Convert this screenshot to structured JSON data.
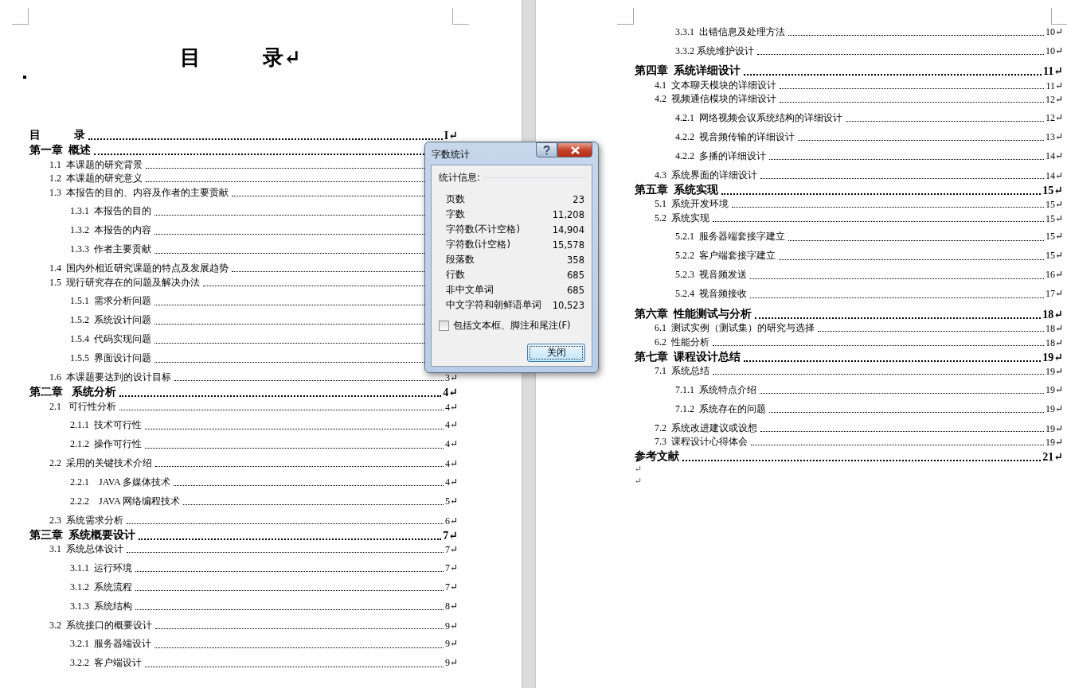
{
  "left_page": {
    "title": "目　　　录↵",
    "entries": [
      {
        "text": "目　　　录",
        "page": "I↵"
      },
      {
        "text": "第一章  概述",
        "children": [
          {
            "text": "1.1  本课题的研究背景"
          },
          {
            "text": "1.2  本课题的研究意义"
          },
          {
            "text": "1.3  本报告的目的、内容及作者的主要贡献",
            "children": [
              {
                "text": "1.3.1  本报告的目的"
              },
              {
                "text": "1.3.2  本报告的内容"
              },
              {
                "text": "1.3.3  作者主要贡献"
              }
            ]
          },
          {
            "text": "1.4  国内外相近研究课题的特点及发展趋势"
          },
          {
            "text": "1.5  现行研究存在的问题及解决办法",
            "children": [
              {
                "text": "1.5.1  需求分析问题"
              },
              {
                "text": "1.5.2  系统设计问题"
              },
              {
                "text": "1.5.4  代码实现问题"
              },
              {
                "text": "1.5.5  界面设计问题"
              }
            ]
          },
          {
            "text": "1.6  本课题要达到的设计目标",
            "page": "3↵"
          }
        ]
      },
      {
        "text": "第二章   系统分析",
        "page": "4↵",
        "children": [
          {
            "text": "2.1   可行性分析",
            "page": "4↵",
            "children": [
              {
                "text": "2.1.1  技术可行性",
                "page": "4↵"
              },
              {
                "text": "2.1.2  操作可行性",
                "page": "4↵"
              }
            ]
          },
          {
            "text": "2.2  采用的关键技术介绍",
            "page": "4↵",
            "children": [
              {
                "text": "2.2.1    JAVA 多媒体技术",
                "page": "4↵"
              },
              {
                "text": "2.2.2    JAVA 网络编程技术",
                "page": "5↵"
              }
            ]
          },
          {
            "text": "2.3  系统需求分析",
            "page": "6↵"
          }
        ]
      },
      {
        "text": "第三章  系统概要设计",
        "page": "7↵",
        "children": [
          {
            "text": "3.1  系统总体设计",
            "page": "7↵",
            "children": [
              {
                "text": "3.1.1  运行环境",
                "page": "7↵"
              },
              {
                "text": "3.1.2  系统流程",
                "page": "7↵"
              },
              {
                "text": "3.1.3  系统结构",
                "page": "8↵"
              }
            ]
          },
          {
            "text": "3.2  系统接口的概要设计",
            "page": "9↵",
            "children": [
              {
                "text": "3.2.1  服务器端设计",
                "page": "9↵"
              },
              {
                "text": "3.2.2  客户端设计",
                "page": "9↵"
              }
            ]
          }
        ]
      }
    ]
  },
  "right_page": {
    "carried_over": [
      {
        "text": "3.3.1  出错信息及处理方法",
        "page": "10↵"
      },
      {
        "text": "3.3.2 系统维护设计",
        "page": "10↵"
      }
    ],
    "entries": [
      {
        "text": "第四章  系统详细设计",
        "page": "11↵",
        "children": [
          {
            "text": "4.1  文本聊天模块的详细设计",
            "page": "11↵"
          },
          {
            "text": "4.2  视频通信模块的详细设计",
            "page": "12↵",
            "children": [
              {
                "text": "4.2.1  网络视频会议系统结构的详细设计",
                "page": "12↵"
              },
              {
                "text": "4.2.2  视音频传输的详细设计",
                "page": "13↵"
              },
              {
                "text": "4.2.2  多播的详细设计",
                "page": "14↵"
              }
            ]
          },
          {
            "text": "4.3  系统界面的详细设计",
            "page": "14↵"
          }
        ]
      },
      {
        "text": "第五章  系统实现",
        "page": "15↵",
        "children": [
          {
            "text": "5.1  系统开发环境",
            "page": "15↵"
          },
          {
            "text": "5.2  系统实现",
            "page": "15↵",
            "children": [
              {
                "text": "5.2.1  服务器端套接字建立",
                "page": "15↵"
              },
              {
                "text": "5.2.2  客户端套接字建立",
                "page": "15↵"
              },
              {
                "text": "5.2.3  视音频发送",
                "page": "16↵"
              },
              {
                "text": "5.2.4  视音频接收",
                "page": "17↵"
              }
            ]
          }
        ]
      },
      {
        "text": "第六章  性能测试与分析",
        "page": "18↵",
        "children": [
          {
            "text": "6.1  测试实例（测试集）的研究与选择",
            "page": "18↵"
          },
          {
            "text": "6.2  性能分析",
            "page": "18↵"
          }
        ]
      },
      {
        "text": "第七章  课程设计总结",
        "page": "19↵",
        "children": [
          {
            "text": "7.1  系统总结",
            "page": "19↵",
            "children": [
              {
                "text": "7.1.1  系统特点介绍",
                "page": "19↵"
              },
              {
                "text": "7.1.2  系统存在的问题",
                "page": "19↵"
              }
            ]
          },
          {
            "text": "7.2  系统改进建议或设想",
            "page": "19↵"
          },
          {
            "text": "7.3  课程设计心得体会",
            "page": "19↵"
          }
        ]
      },
      {
        "text": "参考文献",
        "page": "21↵"
      }
    ],
    "trailing_marks": [
      "↵",
      "↵"
    ]
  },
  "dialog": {
    "title": "字数统计",
    "group_label": "统计信息:",
    "stats": [
      {
        "label": "页数",
        "value": "23"
      },
      {
        "label": "字数",
        "value": "11,208"
      },
      {
        "label": "字符数(不计空格)",
        "value": "14,904"
      },
      {
        "label": "字符数(计空格)",
        "value": "15,578"
      },
      {
        "label": "段落数",
        "value": "358"
      },
      {
        "label": "行数",
        "value": "685"
      },
      {
        "label": "非中文单词",
        "value": "685"
      },
      {
        "label": "中文字符和朝鲜语单词",
        "value": "10,523"
      }
    ],
    "include_textboxes": {
      "label": "包括文本框、脚注和尾注(F)",
      "checked": false
    },
    "close_button": "关闭"
  }
}
